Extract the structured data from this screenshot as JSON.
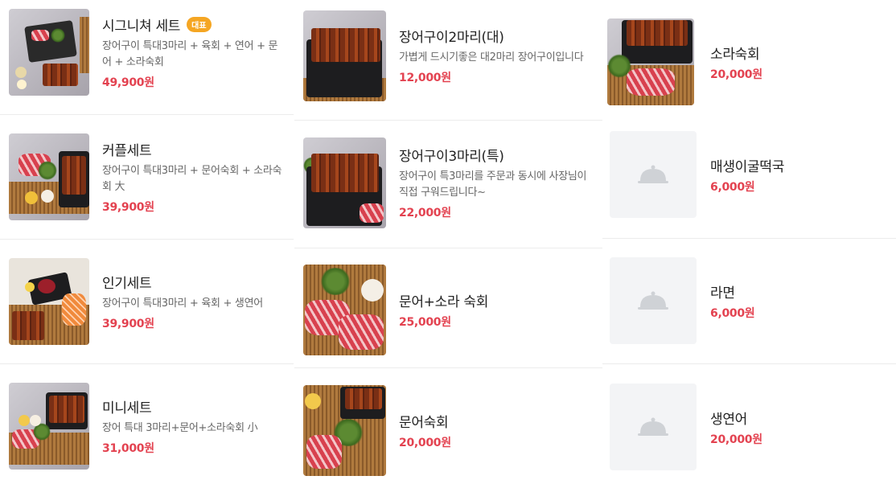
{
  "columns": [
    {
      "items": [
        {
          "name": "시그니쳐 세트",
          "badge": "대표",
          "desc": "장어구이 특대3마리 + 육회 + 연어 + 문어 + 소라숙회",
          "price": "49,900원"
        },
        {
          "name": "커플세트",
          "desc": "장어구이 특대3마리 + 문어숙회 + 소라숙회 大",
          "price": "39,900원"
        },
        {
          "name": "인기세트",
          "desc": "장어구이 특대3마리 + 육회 + 생연어",
          "price": "39,900원"
        },
        {
          "name": "미니세트",
          "desc": "장어 특대 3마리+문어+소라숙회 小",
          "price": "31,000원"
        }
      ]
    },
    {
      "items": [
        {
          "name": "장어구이2마리(대)",
          "desc": "가볍게 드시기좋은 대2마리 장어구이입니다",
          "price": "12,000원"
        },
        {
          "name": "장어구이3마리(특)",
          "desc": "장어구이 특3마리를 주문과 동시에 사장님이 직접 구워드립니다~",
          "price": "22,000원"
        },
        {
          "name": "문어+소라 숙회",
          "price": "25,000원"
        },
        {
          "name": "문어숙회",
          "price": "20,000원"
        }
      ]
    },
    {
      "items": [
        {
          "name": "소라숙회",
          "price": "20,000원"
        },
        {
          "name": "매생이굴떡국",
          "price": "6,000원"
        },
        {
          "name": "라면",
          "price": "6,000원"
        },
        {
          "name": "생연어",
          "price": "20,000원"
        }
      ]
    }
  ],
  "icons": {
    "placeholder": "food-cloche-icon"
  },
  "colors": {
    "price": "#e34250",
    "badge": "#f5a623",
    "placeholder_bg": "#f3f4f6"
  }
}
